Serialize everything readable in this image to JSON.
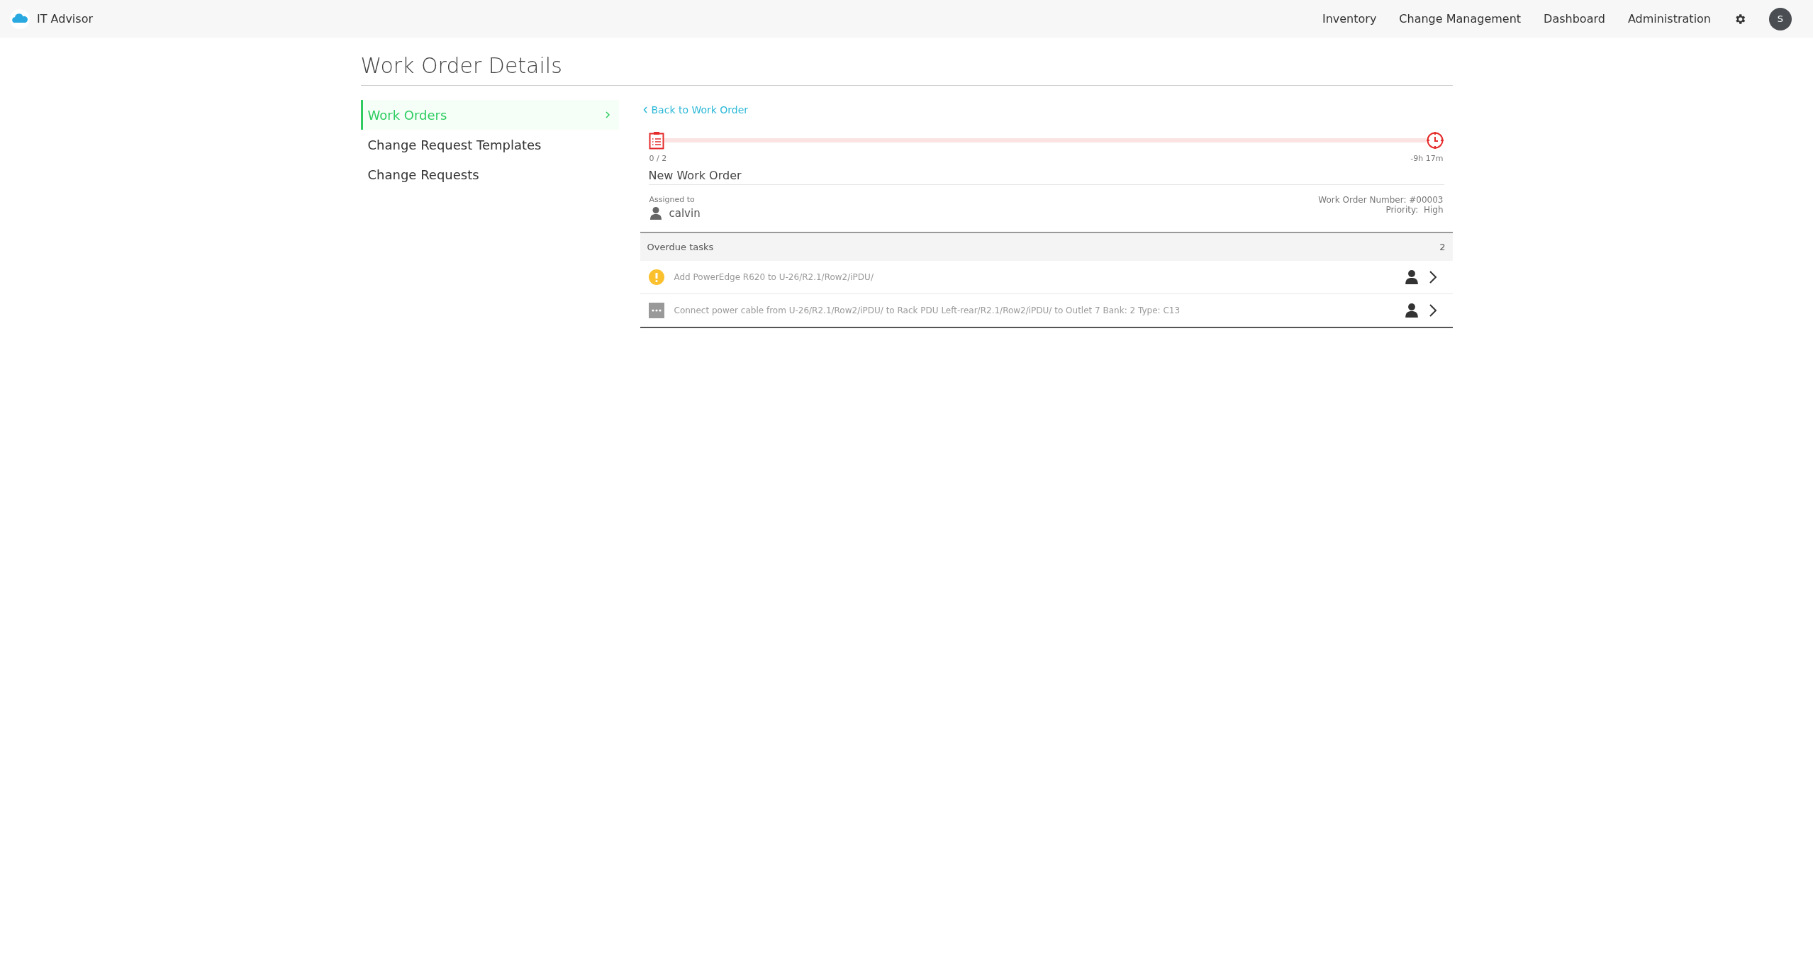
{
  "app": {
    "name": "IT Advisor"
  },
  "nav": {
    "items": [
      {
        "label": "Inventory"
      },
      {
        "label": "Change Management"
      },
      {
        "label": "Dashboard"
      },
      {
        "label": "Administration"
      }
    ],
    "avatar": "S"
  },
  "page": {
    "title": "Work Order Details"
  },
  "sidebar": {
    "items": [
      {
        "label": "Work Orders",
        "selected": true
      },
      {
        "label": "Change Request Templates",
        "selected": false
      },
      {
        "label": "Change Requests",
        "selected": false
      }
    ]
  },
  "work_order": {
    "back_link": "Back to Work Order",
    "progress": {
      "count": "0 / 2",
      "time_left": "-9h 17m"
    },
    "name": "New Work Order",
    "assigned_label": "Assigned to",
    "assignee": "calvin",
    "number": "Work Order Number: #00003",
    "priority": "Priority:  High"
  },
  "tasks": {
    "title": "Overdue tasks",
    "count": "2",
    "items": [
      {
        "kind": "warning",
        "text": "Add PowerEdge R620 to U-26/R2.1/Row2/iPDU/"
      },
      {
        "kind": "pending",
        "text": "Connect power cable from U-26/R2.1/Row2/iPDU/ to Rack PDU Left-rear/R2.1/Row2/iPDU/ to Outlet 7 Bank: 2 Type: C13"
      }
    ]
  }
}
